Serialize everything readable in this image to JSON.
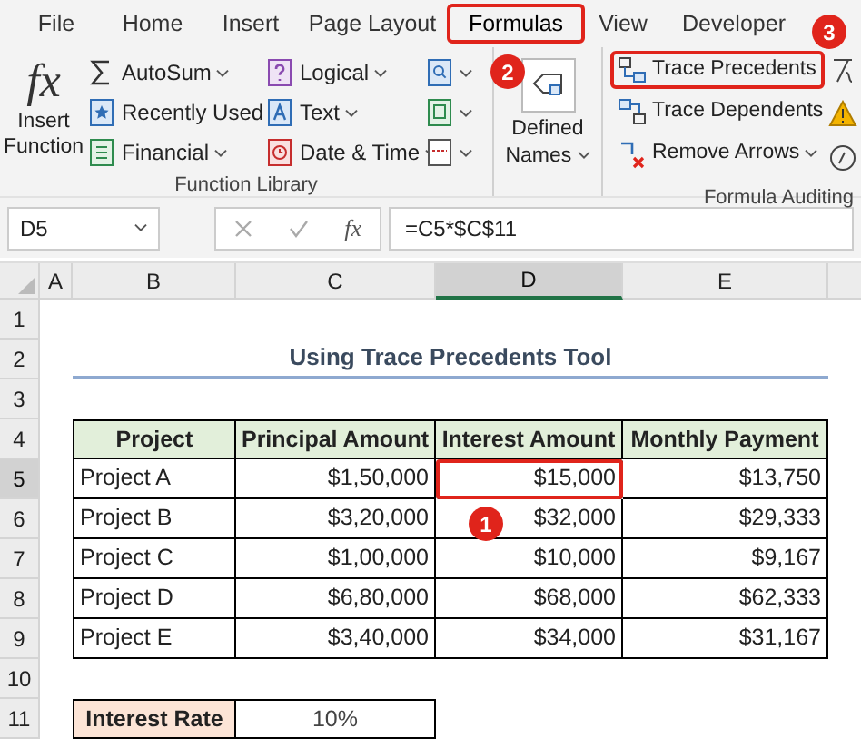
{
  "ribbon_tabs": [
    {
      "label": "File",
      "selected": false,
      "highlighted": false
    },
    {
      "label": "Home",
      "selected": false,
      "highlighted": false
    },
    {
      "label": "Insert",
      "selected": false,
      "highlighted": false
    },
    {
      "label": "Page Layout",
      "selected": false,
      "highlighted": false
    },
    {
      "label": "Formulas",
      "selected": true,
      "highlighted": true,
      "badge": "2"
    },
    {
      "label": "View",
      "selected": false,
      "highlighted": false
    },
    {
      "label": "Developer",
      "selected": false,
      "highlighted": false
    }
  ],
  "function_library": {
    "insert_function": {
      "icon_text": "fx",
      "label": "Insert Function"
    },
    "columns": [
      [
        {
          "label": "AutoSum",
          "kind": "sum",
          "dropdown": true
        },
        {
          "label": "Recently Used",
          "kind": "star",
          "dropdown": true
        },
        {
          "label": "Financial",
          "kind": "book",
          "dropdown": true
        }
      ],
      [
        {
          "label": "Logical",
          "kind": "question",
          "dropdown": true
        },
        {
          "label": "Text",
          "kind": "text",
          "dropdown": true
        },
        {
          "label": "Date & Time",
          "kind": "clock",
          "dropdown": true
        }
      ],
      [
        {
          "kind": "search",
          "dropdown": true
        },
        {
          "kind": "math",
          "dropdown": true
        },
        {
          "kind": "more",
          "dropdown": true
        }
      ]
    ],
    "group_label": "Function Library"
  },
  "defined_names": {
    "label": "Defined Names",
    "dropdown": true
  },
  "formula_auditing": {
    "buttons": [
      {
        "label": "Trace Precedents",
        "kind": "precedents",
        "highlighted": true,
        "badge": "3",
        "dropdown": false
      },
      {
        "label": "Trace Dependents",
        "kind": "dependents",
        "highlighted": false,
        "dropdown": false
      },
      {
        "label": "Remove Arrows",
        "kind": "remove",
        "highlighted": false,
        "dropdown": true
      }
    ],
    "group_label": "Formula Auditing"
  },
  "formula_bar": {
    "name_box": "D5",
    "fx": "fx",
    "formula": "=C5*$C$11"
  },
  "sheet": {
    "columns": [
      {
        "label": "A",
        "selected": false
      },
      {
        "label": "B",
        "selected": false
      },
      {
        "label": "C",
        "selected": false
      },
      {
        "label": "D",
        "selected": true
      },
      {
        "label": "E",
        "selected": false
      }
    ],
    "rows": [
      {
        "label": "1",
        "selected": false
      },
      {
        "label": "2",
        "selected": false
      },
      {
        "label": "3",
        "selected": false
      },
      {
        "label": "4",
        "selected": false
      },
      {
        "label": "5",
        "selected": true
      },
      {
        "label": "6",
        "selected": false
      },
      {
        "label": "7",
        "selected": false
      },
      {
        "label": "8",
        "selected": false
      },
      {
        "label": "9",
        "selected": false
      },
      {
        "label": "10",
        "selected": false
      },
      {
        "label": "11",
        "selected": false
      }
    ],
    "title": "Using Trace Precedents Tool",
    "table": {
      "columns": [
        "Project",
        "Principal Amount",
        "Interest Amount",
        "Monthly Payment"
      ],
      "rows": [
        [
          {
            "text": "Project A",
            "selected": false
          },
          {
            "text": "$1,50,000",
            "selected": false
          },
          {
            "text": "$15,000",
            "selected": true,
            "badge": "1"
          },
          {
            "text": "$13,750",
            "selected": false
          }
        ],
        [
          {
            "text": "Project B",
            "selected": false
          },
          {
            "text": "$3,20,000",
            "selected": false
          },
          {
            "text": "$32,000",
            "selected": false
          },
          {
            "text": "$29,333",
            "selected": false
          }
        ],
        [
          {
            "text": "Project C",
            "selected": false
          },
          {
            "text": "$1,00,000",
            "selected": false
          },
          {
            "text": "$10,000",
            "selected": false
          },
          {
            "text": "$9,167",
            "selected": false
          }
        ],
        [
          {
            "text": "Project D",
            "selected": false
          },
          {
            "text": "$6,80,000",
            "selected": false
          },
          {
            "text": "$68,000",
            "selected": false
          },
          {
            "text": "$62,333",
            "selected": false
          }
        ],
        [
          {
            "text": "Project E",
            "selected": false
          },
          {
            "text": "$3,40,000",
            "selected": false
          },
          {
            "text": "$34,000",
            "selected": false
          },
          {
            "text": "$31,167",
            "selected": false
          }
        ]
      ]
    },
    "interest_rate": {
      "label": "Interest Rate",
      "value": "10%"
    }
  }
}
